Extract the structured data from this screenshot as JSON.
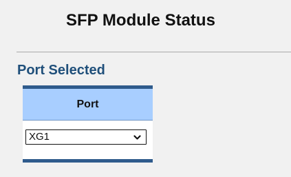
{
  "page": {
    "title": "SFP Module Status"
  },
  "port_selected": {
    "label": "Port Selected",
    "column_header": "Port",
    "selected_port": "XG1"
  },
  "colors": {
    "background": "#f1f1f1",
    "section_label": "#1f4f7a",
    "table_border": "#2f5b8c",
    "table_header": "#a8ceff"
  },
  "icons": {
    "dropdown": "chevron-down-icon"
  }
}
